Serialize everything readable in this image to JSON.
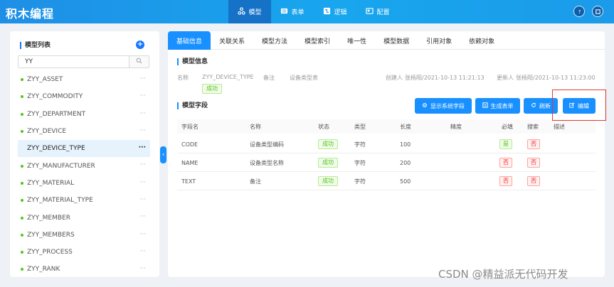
{
  "app": {
    "title": "积木编程"
  },
  "nav": [
    {
      "label": "模型",
      "icon": "cluster-icon"
    },
    {
      "label": "表单",
      "icon": "form-icon"
    },
    {
      "label": "逻辑",
      "icon": "logic-icon"
    },
    {
      "label": "配置",
      "icon": "config-icon"
    }
  ],
  "sidebar": {
    "title": "模型列表",
    "search_value": "YY",
    "items": [
      {
        "label": "ZYY_ASSET"
      },
      {
        "label": "ZYY_COMMODITY"
      },
      {
        "label": "ZYY_DEPARTMENT"
      },
      {
        "label": "ZYY_DEVICE"
      },
      {
        "label": "ZYY_DEVICE_TYPE"
      },
      {
        "label": "ZYY_MANUFACTURER"
      },
      {
        "label": "ZYY_MATERIAL"
      },
      {
        "label": "ZYY_MATERIAL_TYPE"
      },
      {
        "label": "ZYY_MEMBER"
      },
      {
        "label": "ZYY_MEMBERS"
      },
      {
        "label": "ZYY_PROCESS"
      },
      {
        "label": "ZYY_RANK"
      }
    ],
    "selected_index": 4,
    "more": "···"
  },
  "tabs": [
    "基础信息",
    "关联关系",
    "模型方法",
    "模型索引",
    "唯一性",
    "模型数据",
    "引用对象",
    "依赖对象"
  ],
  "info": {
    "section_title": "模型信息",
    "name_label": "名称",
    "name_value": "ZYY_DEVICE_TYPE",
    "remark_label": "备注",
    "remark_value": "设备类型表",
    "creator_label": "创建人",
    "creator_value": "张杨阳/2021-10-13 11:21:13",
    "updater_label": "更新人",
    "updater_value": "张杨阳/2021-10-13 11:23:00",
    "status": "成功"
  },
  "fields": {
    "section_title": "模型字段",
    "buttons": {
      "show_system": "显示系统字段",
      "gen_form": "生成表单",
      "refresh": "刷新",
      "edit": "编辑"
    },
    "columns": [
      "字段名",
      "名称",
      "状态",
      "类型",
      "长度",
      "精度",
      "必填",
      "搜索",
      "描述"
    ],
    "rows": [
      {
        "field": "CODE",
        "name": "设备类型编码",
        "status": "成功",
        "type": "字符",
        "length": "100",
        "precision": "",
        "required": "是",
        "search": "否",
        "desc": ""
      },
      {
        "field": "NAME",
        "name": "设备类型名称",
        "status": "成功",
        "type": "字符",
        "length": "200",
        "precision": "",
        "required": "否",
        "search": "否",
        "desc": ""
      },
      {
        "field": "TEXT",
        "name": "备注",
        "status": "成功",
        "type": "字符",
        "length": "500",
        "precision": "",
        "required": "否",
        "search": "否",
        "desc": ""
      }
    ]
  },
  "watermark": "CSDN @精益派无代码开发",
  "colors": {
    "primary": "#1890ff",
    "topbar": "#1e8fe6",
    "success": "#52c41a",
    "danger": "#f5222d",
    "highlight": "#e53935"
  }
}
